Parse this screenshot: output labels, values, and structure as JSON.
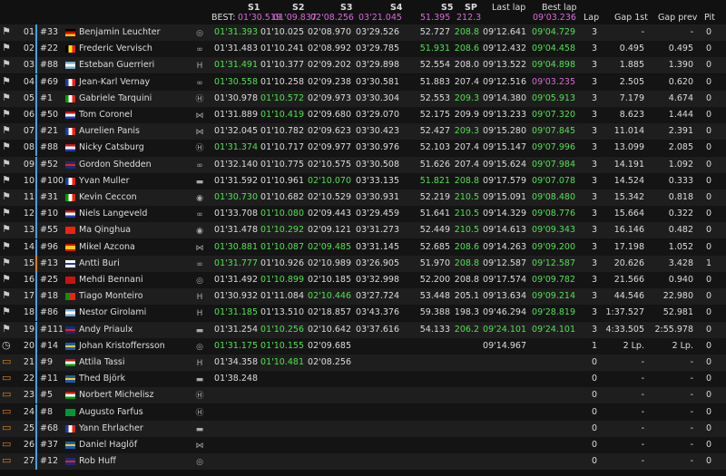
{
  "header": {
    "best_label": "BEST:",
    "columns": {
      "s1": "S1",
      "s2": "S2",
      "s3": "S3",
      "s4": "S4",
      "s5": "S5",
      "sp": "SP",
      "last_lap": "Last lap",
      "best_lap": "Best lap",
      "lap": "Lap",
      "gap_first": "Gap 1st",
      "gap_prev": "Gap prev",
      "pit": "Pit"
    },
    "best": {
      "s1": "01'30.519",
      "s2": "01'09.837",
      "s3": "02'08.256",
      "s4": "03'21.045",
      "s5": "51.395",
      "sp": "212.3",
      "best_lap": "09'03.236"
    }
  },
  "colors": {
    "green": "#52e052",
    "purple": "#d86ad8",
    "white": "#dddddd",
    "bar_blue": "#4aa0e0",
    "bar_orange": "#e08020"
  },
  "rows": [
    {
      "pos": "01",
      "num": "#33",
      "name": "Benjamin Leuchter",
      "flag": "de",
      "car": "vw",
      "status": "flag",
      "bar": "blue",
      "s1": "01'31.393",
      "s1c": "green",
      "s2": "01'10.025",
      "s2c": "white",
      "s3": "02'08.970",
      "s3c": "white",
      "s4": "03'29.526",
      "s4c": "white",
      "s5": "52.727",
      "s5c": "white",
      "sp": "208.8",
      "spc": "green",
      "last": "09'12.641",
      "lastc": "white",
      "best": "09'04.729",
      "bestc": "green",
      "lap": "3",
      "g1": "-",
      "gp": "-",
      "pit": "0"
    },
    {
      "pos": "02",
      "num": "#22",
      "name": "Frederic Vervisch",
      "flag": "be",
      "car": "audi",
      "status": "flag",
      "bar": "blue",
      "s1": "01'31.483",
      "s1c": "white",
      "s2": "01'10.241",
      "s2c": "white",
      "s3": "02'08.992",
      "s3c": "white",
      "s4": "03'29.785",
      "s4c": "white",
      "s5": "51.931",
      "s5c": "green",
      "sp": "208.6",
      "spc": "green",
      "last": "09'12.432",
      "lastc": "white",
      "best": "09'04.458",
      "bestc": "green",
      "lap": "3",
      "g1": "0.495",
      "gp": "0.495",
      "pit": "0"
    },
    {
      "pos": "03",
      "num": "#88",
      "name": "Esteban Guerrieri",
      "flag": "ar",
      "car": "honda",
      "status": "flag",
      "bar": "blue",
      "s1": "01'31.491",
      "s1c": "green",
      "s2": "01'10.377",
      "s2c": "white",
      "s3": "02'09.202",
      "s3c": "white",
      "s4": "03'29.898",
      "s4c": "white",
      "s5": "52.554",
      "s5c": "white",
      "sp": "208.0",
      "spc": "white",
      "last": "09'13.522",
      "lastc": "white",
      "best": "09'04.898",
      "bestc": "green",
      "lap": "3",
      "g1": "1.885",
      "gp": "1.390",
      "pit": "0"
    },
    {
      "pos": "04",
      "num": "#69",
      "name": "Jean-Karl Vernay",
      "flag": "fr",
      "car": "audi",
      "status": "flag",
      "bar": "blue",
      "s1": "01'30.558",
      "s1c": "green",
      "s2": "01'10.258",
      "s2c": "white",
      "s3": "02'09.238",
      "s3c": "white",
      "s4": "03'30.581",
      "s4c": "white",
      "s5": "51.883",
      "s5c": "white",
      "sp": "207.4",
      "spc": "white",
      "last": "09'12.516",
      "lastc": "white",
      "best": "09'03.235",
      "bestc": "purple",
      "lap": "3",
      "g1": "2.505",
      "gp": "0.620",
      "pit": "0"
    },
    {
      "pos": "05",
      "num": "#1",
      "name": "Gabriele Tarquini",
      "flag": "it",
      "car": "hyundai",
      "status": "flag",
      "bar": "blue",
      "s1": "01'30.978",
      "s1c": "white",
      "s2": "01'10.572",
      "s2c": "green",
      "s3": "02'09.973",
      "s3c": "white",
      "s4": "03'30.304",
      "s4c": "white",
      "s5": "52.553",
      "s5c": "white",
      "sp": "209.3",
      "spc": "green",
      "last": "09'14.380",
      "lastc": "white",
      "best": "09'05.913",
      "bestc": "green",
      "lap": "3",
      "g1": "7.179",
      "gp": "4.674",
      "pit": "0"
    },
    {
      "pos": "06",
      "num": "#50",
      "name": "Tom Coronel",
      "flag": "nl",
      "car": "cupra",
      "status": "flag",
      "bar": "blue",
      "s1": "01'31.889",
      "s1c": "white",
      "s2": "01'10.419",
      "s2c": "green",
      "s3": "02'09.680",
      "s3c": "white",
      "s4": "03'29.070",
      "s4c": "white",
      "s5": "52.175",
      "s5c": "white",
      "sp": "209.9",
      "spc": "white",
      "last": "09'13.233",
      "lastc": "white",
      "best": "09'07.320",
      "bestc": "green",
      "lap": "3",
      "g1": "8.623",
      "gp": "1.444",
      "pit": "0"
    },
    {
      "pos": "07",
      "num": "#21",
      "name": "Aurelien Panis",
      "flag": "fr",
      "car": "cupra",
      "status": "flag",
      "bar": "blue",
      "s1": "01'32.045",
      "s1c": "white",
      "s2": "01'10.782",
      "s2c": "white",
      "s3": "02'09.623",
      "s3c": "white",
      "s4": "03'30.423",
      "s4c": "white",
      "s5": "52.427",
      "s5c": "white",
      "sp": "209.3",
      "spc": "green",
      "last": "09'15.280",
      "lastc": "white",
      "best": "09'07.845",
      "bestc": "green",
      "lap": "3",
      "g1": "11.014",
      "gp": "2.391",
      "pit": "0"
    },
    {
      "pos": "08",
      "num": "#88",
      "name": "Nicky Catsburg",
      "flag": "nl",
      "car": "hyundai",
      "status": "flag",
      "bar": "blue",
      "s1": "01'31.374",
      "s1c": "green",
      "s2": "01'10.717",
      "s2c": "white",
      "s3": "02'09.977",
      "s3c": "white",
      "s4": "03'30.976",
      "s4c": "white",
      "s5": "52.103",
      "s5c": "white",
      "sp": "207.4",
      "spc": "white",
      "last": "09'15.147",
      "lastc": "white",
      "best": "09'07.996",
      "bestc": "green",
      "lap": "3",
      "g1": "13.099",
      "gp": "2.085",
      "pit": "0"
    },
    {
      "pos": "09",
      "num": "#52",
      "name": "Gordon Shedden",
      "flag": "gb",
      "car": "audi",
      "status": "flag",
      "bar": "blue",
      "s1": "01'32.140",
      "s1c": "white",
      "s2": "01'10.775",
      "s2c": "white",
      "s3": "02'10.575",
      "s3c": "white",
      "s4": "03'30.508",
      "s4c": "white",
      "s5": "51.626",
      "s5c": "white",
      "sp": "207.4",
      "spc": "white",
      "last": "09'15.624",
      "lastc": "white",
      "best": "09'07.984",
      "bestc": "green",
      "lap": "3",
      "g1": "14.191",
      "gp": "1.092",
      "pit": "0"
    },
    {
      "pos": "10",
      "num": "#100",
      "name": "Yvan Muller",
      "flag": "fr",
      "car": "lynk",
      "status": "flag",
      "bar": "blue",
      "s1": "01'31.592",
      "s1c": "white",
      "s2": "01'10.961",
      "s2c": "white",
      "s3": "02'10.070",
      "s3c": "green",
      "s4": "03'33.135",
      "s4c": "white",
      "s5": "51.821",
      "s5c": "green",
      "sp": "208.8",
      "spc": "green",
      "last": "09'17.579",
      "lastc": "white",
      "best": "09'07.078",
      "bestc": "green",
      "lap": "3",
      "g1": "14.524",
      "gp": "0.333",
      "pit": "0"
    },
    {
      "pos": "11",
      "num": "#31",
      "name": "Kevin Ceccon",
      "flag": "it",
      "car": "alfa",
      "status": "flag",
      "bar": "blue",
      "s1": "01'30.730",
      "s1c": "green",
      "s2": "01'10.682",
      "s2c": "white",
      "s3": "02'10.529",
      "s3c": "white",
      "s4": "03'30.931",
      "s4c": "white",
      "s5": "52.219",
      "s5c": "white",
      "sp": "210.5",
      "spc": "green",
      "last": "09'15.091",
      "lastc": "white",
      "best": "09'08.480",
      "bestc": "green",
      "lap": "3",
      "g1": "15.342",
      "gp": "0.818",
      "pit": "0"
    },
    {
      "pos": "12",
      "num": "#10",
      "name": "Niels Langeveld",
      "flag": "nl",
      "car": "audi",
      "status": "flag",
      "bar": "blue",
      "s1": "01'33.708",
      "s1c": "white",
      "s2": "01'10.080",
      "s2c": "green",
      "s3": "02'09.443",
      "s3c": "white",
      "s4": "03'29.459",
      "s4c": "white",
      "s5": "51.641",
      "s5c": "white",
      "sp": "210.5",
      "spc": "green",
      "last": "09'14.329",
      "lastc": "white",
      "best": "09'08.776",
      "bestc": "green",
      "lap": "3",
      "g1": "15.664",
      "gp": "0.322",
      "pit": "0"
    },
    {
      "pos": "13",
      "num": "#55",
      "name": "Ma Qinghua",
      "flag": "cn",
      "car": "alfa",
      "status": "flag",
      "bar": "blue",
      "s1": "01'31.478",
      "s1c": "white",
      "s2": "01'10.292",
      "s2c": "green",
      "s3": "02'09.121",
      "s3c": "white",
      "s4": "03'31.273",
      "s4c": "white",
      "s5": "52.449",
      "s5c": "white",
      "sp": "210.5",
      "spc": "green",
      "last": "09'14.613",
      "lastc": "white",
      "best": "09'09.343",
      "bestc": "green",
      "lap": "3",
      "g1": "16.146",
      "gp": "0.482",
      "pit": "0"
    },
    {
      "pos": "14",
      "num": "#96",
      "name": "Mikel Azcona",
      "flag": "es",
      "car": "cupra",
      "status": "flag",
      "bar": "blue",
      "s1": "01'30.881",
      "s1c": "green",
      "s2": "01'10.087",
      "s2c": "green",
      "s3": "02'09.485",
      "s3c": "green",
      "s4": "03'31.145",
      "s4c": "white",
      "s5": "52.685",
      "s5c": "white",
      "sp": "208.6",
      "spc": "green",
      "last": "09'14.263",
      "lastc": "white",
      "best": "09'09.200",
      "bestc": "green",
      "lap": "3",
      "g1": "17.198",
      "gp": "1.052",
      "pit": "0"
    },
    {
      "pos": "15",
      "num": "#13",
      "name": "Antti Buri",
      "flag": "fi",
      "car": "audi",
      "status": "flag",
      "bar": "orange",
      "s1": "01'31.777",
      "s1c": "green",
      "s2": "01'10.926",
      "s2c": "white",
      "s3": "02'10.989",
      "s3c": "white",
      "s4": "03'26.905",
      "s4c": "white",
      "s5": "51.970",
      "s5c": "white",
      "sp": "208.8",
      "spc": "green",
      "last": "09'12.587",
      "lastc": "white",
      "best": "09'12.587",
      "bestc": "green",
      "lap": "3",
      "g1": "20.626",
      "gp": "3.428",
      "pit": "1"
    },
    {
      "pos": "16",
      "num": "#25",
      "name": "Mehdi Bennani",
      "flag": "ma",
      "car": "vw",
      "status": "flag",
      "bar": "blue",
      "s1": "01'31.492",
      "s1c": "white",
      "s2": "01'10.899",
      "s2c": "green",
      "s3": "02'10.185",
      "s3c": "white",
      "s4": "03'32.998",
      "s4c": "white",
      "s5": "52.200",
      "s5c": "white",
      "sp": "208.8",
      "spc": "white",
      "last": "09'17.574",
      "lastc": "white",
      "best": "09'09.782",
      "bestc": "green",
      "lap": "3",
      "g1": "21.566",
      "gp": "0.940",
      "pit": "0"
    },
    {
      "pos": "17",
      "num": "#18",
      "name": "Tiago Monteiro",
      "flag": "pt",
      "car": "honda",
      "status": "flag",
      "bar": "blue",
      "s1": "01'30.932",
      "s1c": "white",
      "s2": "01'11.084",
      "s2c": "white",
      "s3": "02'10.446",
      "s3c": "green",
      "s4": "03'27.724",
      "s4c": "white",
      "s5": "53.448",
      "s5c": "white",
      "sp": "205.1",
      "spc": "white",
      "last": "09'13.634",
      "lastc": "white",
      "best": "09'09.214",
      "bestc": "green",
      "lap": "3",
      "g1": "44.546",
      "gp": "22.980",
      "pit": "0"
    },
    {
      "pos": "18",
      "num": "#86",
      "name": "Nestor Girolami",
      "flag": "ar",
      "car": "honda",
      "status": "flag",
      "bar": "blue",
      "s1": "01'31.185",
      "s1c": "green",
      "s2": "01'13.510",
      "s2c": "white",
      "s3": "02'18.857",
      "s3c": "white",
      "s4": "03'43.376",
      "s4c": "white",
      "s5": "59.388",
      "s5c": "white",
      "sp": "198.3",
      "spc": "white",
      "last": "09'46.294",
      "lastc": "white",
      "best": "09'28.819",
      "bestc": "green",
      "lap": "3",
      "g1": "1:37.527",
      "gp": "52.981",
      "pit": "0"
    },
    {
      "pos": "19",
      "num": "#111",
      "name": "Andy Priaulx",
      "flag": "gb",
      "car": "lynk",
      "status": "flag",
      "bar": "blue",
      "s1": "01'31.254",
      "s1c": "white",
      "s2": "01'10.256",
      "s2c": "green",
      "s3": "02'10.642",
      "s3c": "white",
      "s4": "03'37.616",
      "s4c": "white",
      "s5": "54.133",
      "s5c": "white",
      "sp": "206.2",
      "spc": "green",
      "last": "09'24.101",
      "lastc": "green",
      "best": "09'24.101",
      "bestc": "green",
      "lap": "3",
      "g1": "4:33.505",
      "gp": "2:55.978",
      "pit": "0"
    },
    {
      "pos": "20",
      "num": "#14",
      "name": "Johan Kristoffersson",
      "flag": "se",
      "car": "vw",
      "status": "clock",
      "bar": "blue",
      "s1": "01'31.175",
      "s1c": "green",
      "s2": "01'10.155",
      "s2c": "green",
      "s3": "02'09.685",
      "s3c": "white",
      "s4": "",
      "s4c": "white",
      "s5": "",
      "s5c": "white",
      "sp": "",
      "spc": "white",
      "last": "09'14.967",
      "lastc": "white",
      "best": "",
      "bestc": "white",
      "lap": "1",
      "g1": "2 Lp.",
      "gp": "2 Lp.",
      "pit": "0"
    },
    {
      "pos": "21",
      "num": "#9",
      "name": "Attila Tassi",
      "flag": "hu",
      "car": "honda",
      "status": "pit",
      "bar": "blue",
      "s1": "01'34.358",
      "s1c": "white",
      "s2": "01'10.481",
      "s2c": "green",
      "s3": "02'08.256",
      "s3c": "magenta",
      "s4": "",
      "s4c": "white",
      "s5": "",
      "s5c": "white",
      "sp": "",
      "spc": "white",
      "last": "",
      "lastc": "white",
      "best": "",
      "bestc": "white",
      "lap": "0",
      "g1": "-",
      "gp": "-",
      "pit": "0"
    },
    {
      "pos": "22",
      "num": "#11",
      "name": "Thed Björk",
      "flag": "se",
      "car": "lynk",
      "status": "pit",
      "bar": "blue",
      "s1": "01'38.248",
      "s1c": "white",
      "s2": "",
      "s2c": "white",
      "s3": "",
      "s3c": "white",
      "s4": "",
      "s4c": "white",
      "s5": "",
      "s5c": "white",
      "sp": "",
      "spc": "white",
      "last": "",
      "lastc": "white",
      "best": "",
      "bestc": "white",
      "lap": "0",
      "g1": "-",
      "gp": "-",
      "pit": "0"
    },
    {
      "pos": "23",
      "num": "#5",
      "name": "Norbert Michelisz",
      "flag": "hu",
      "car": "hyundai",
      "status": "pit",
      "bar": "blue",
      "s1": "",
      "s1c": "white",
      "s2": "",
      "s2c": "white",
      "s3": "",
      "s3c": "white",
      "s4": "",
      "s4c": "white",
      "s5": "",
      "s5c": "white",
      "sp": "",
      "spc": "white",
      "last": "",
      "lastc": "white",
      "best": "",
      "bestc": "white",
      "lap": "0",
      "g1": "-",
      "gp": "-",
      "pit": "0"
    },
    {
      "pos": "24",
      "num": "#8",
      "name": "Augusto Farfus",
      "flag": "br",
      "car": "hyundai",
      "status": "pit",
      "bar": "blue",
      "s1": "",
      "s1c": "white",
      "s2": "",
      "s2c": "white",
      "s3": "",
      "s3c": "white",
      "s4": "",
      "s4c": "white",
      "s5": "",
      "s5c": "white",
      "sp": "",
      "spc": "white",
      "last": "",
      "lastc": "white",
      "best": "",
      "bestc": "white",
      "lap": "0",
      "g1": "-",
      "gp": "-",
      "pit": "0"
    },
    {
      "pos": "25",
      "num": "#68",
      "name": "Yann Ehrlacher",
      "flag": "fr",
      "car": "lynk",
      "status": "pit",
      "bar": "blue",
      "s1": "",
      "s1c": "white",
      "s2": "",
      "s2c": "white",
      "s3": "",
      "s3c": "white",
      "s4": "",
      "s4c": "white",
      "s5": "",
      "s5c": "white",
      "sp": "",
      "spc": "white",
      "last": "",
      "lastc": "white",
      "best": "",
      "bestc": "white",
      "lap": "0",
      "g1": "-",
      "gp": "-",
      "pit": "0"
    },
    {
      "pos": "26",
      "num": "#37",
      "name": "Daniel Haglöf",
      "flag": "se",
      "car": "cupra",
      "status": "pit",
      "bar": "blue",
      "s1": "",
      "s1c": "white",
      "s2": "",
      "s2c": "white",
      "s3": "",
      "s3c": "white",
      "s4": "",
      "s4c": "white",
      "s5": "",
      "s5c": "white",
      "sp": "",
      "spc": "white",
      "last": "",
      "lastc": "white",
      "best": "",
      "bestc": "white",
      "lap": "0",
      "g1": "-",
      "gp": "-",
      "pit": "0"
    },
    {
      "pos": "27",
      "num": "#12",
      "name": "Rob Huff",
      "flag": "gb",
      "car": "vw",
      "status": "pit",
      "bar": "blue",
      "s1": "",
      "s1c": "white",
      "s2": "",
      "s2c": "white",
      "s3": "",
      "s3c": "white",
      "s4": "",
      "s4c": "white",
      "s5": "",
      "s5c": "white",
      "sp": "",
      "spc": "white",
      "last": "",
      "lastc": "white",
      "best": "",
      "bestc": "white",
      "lap": "0",
      "g1": "-",
      "gp": "-",
      "pit": "0"
    }
  ]
}
